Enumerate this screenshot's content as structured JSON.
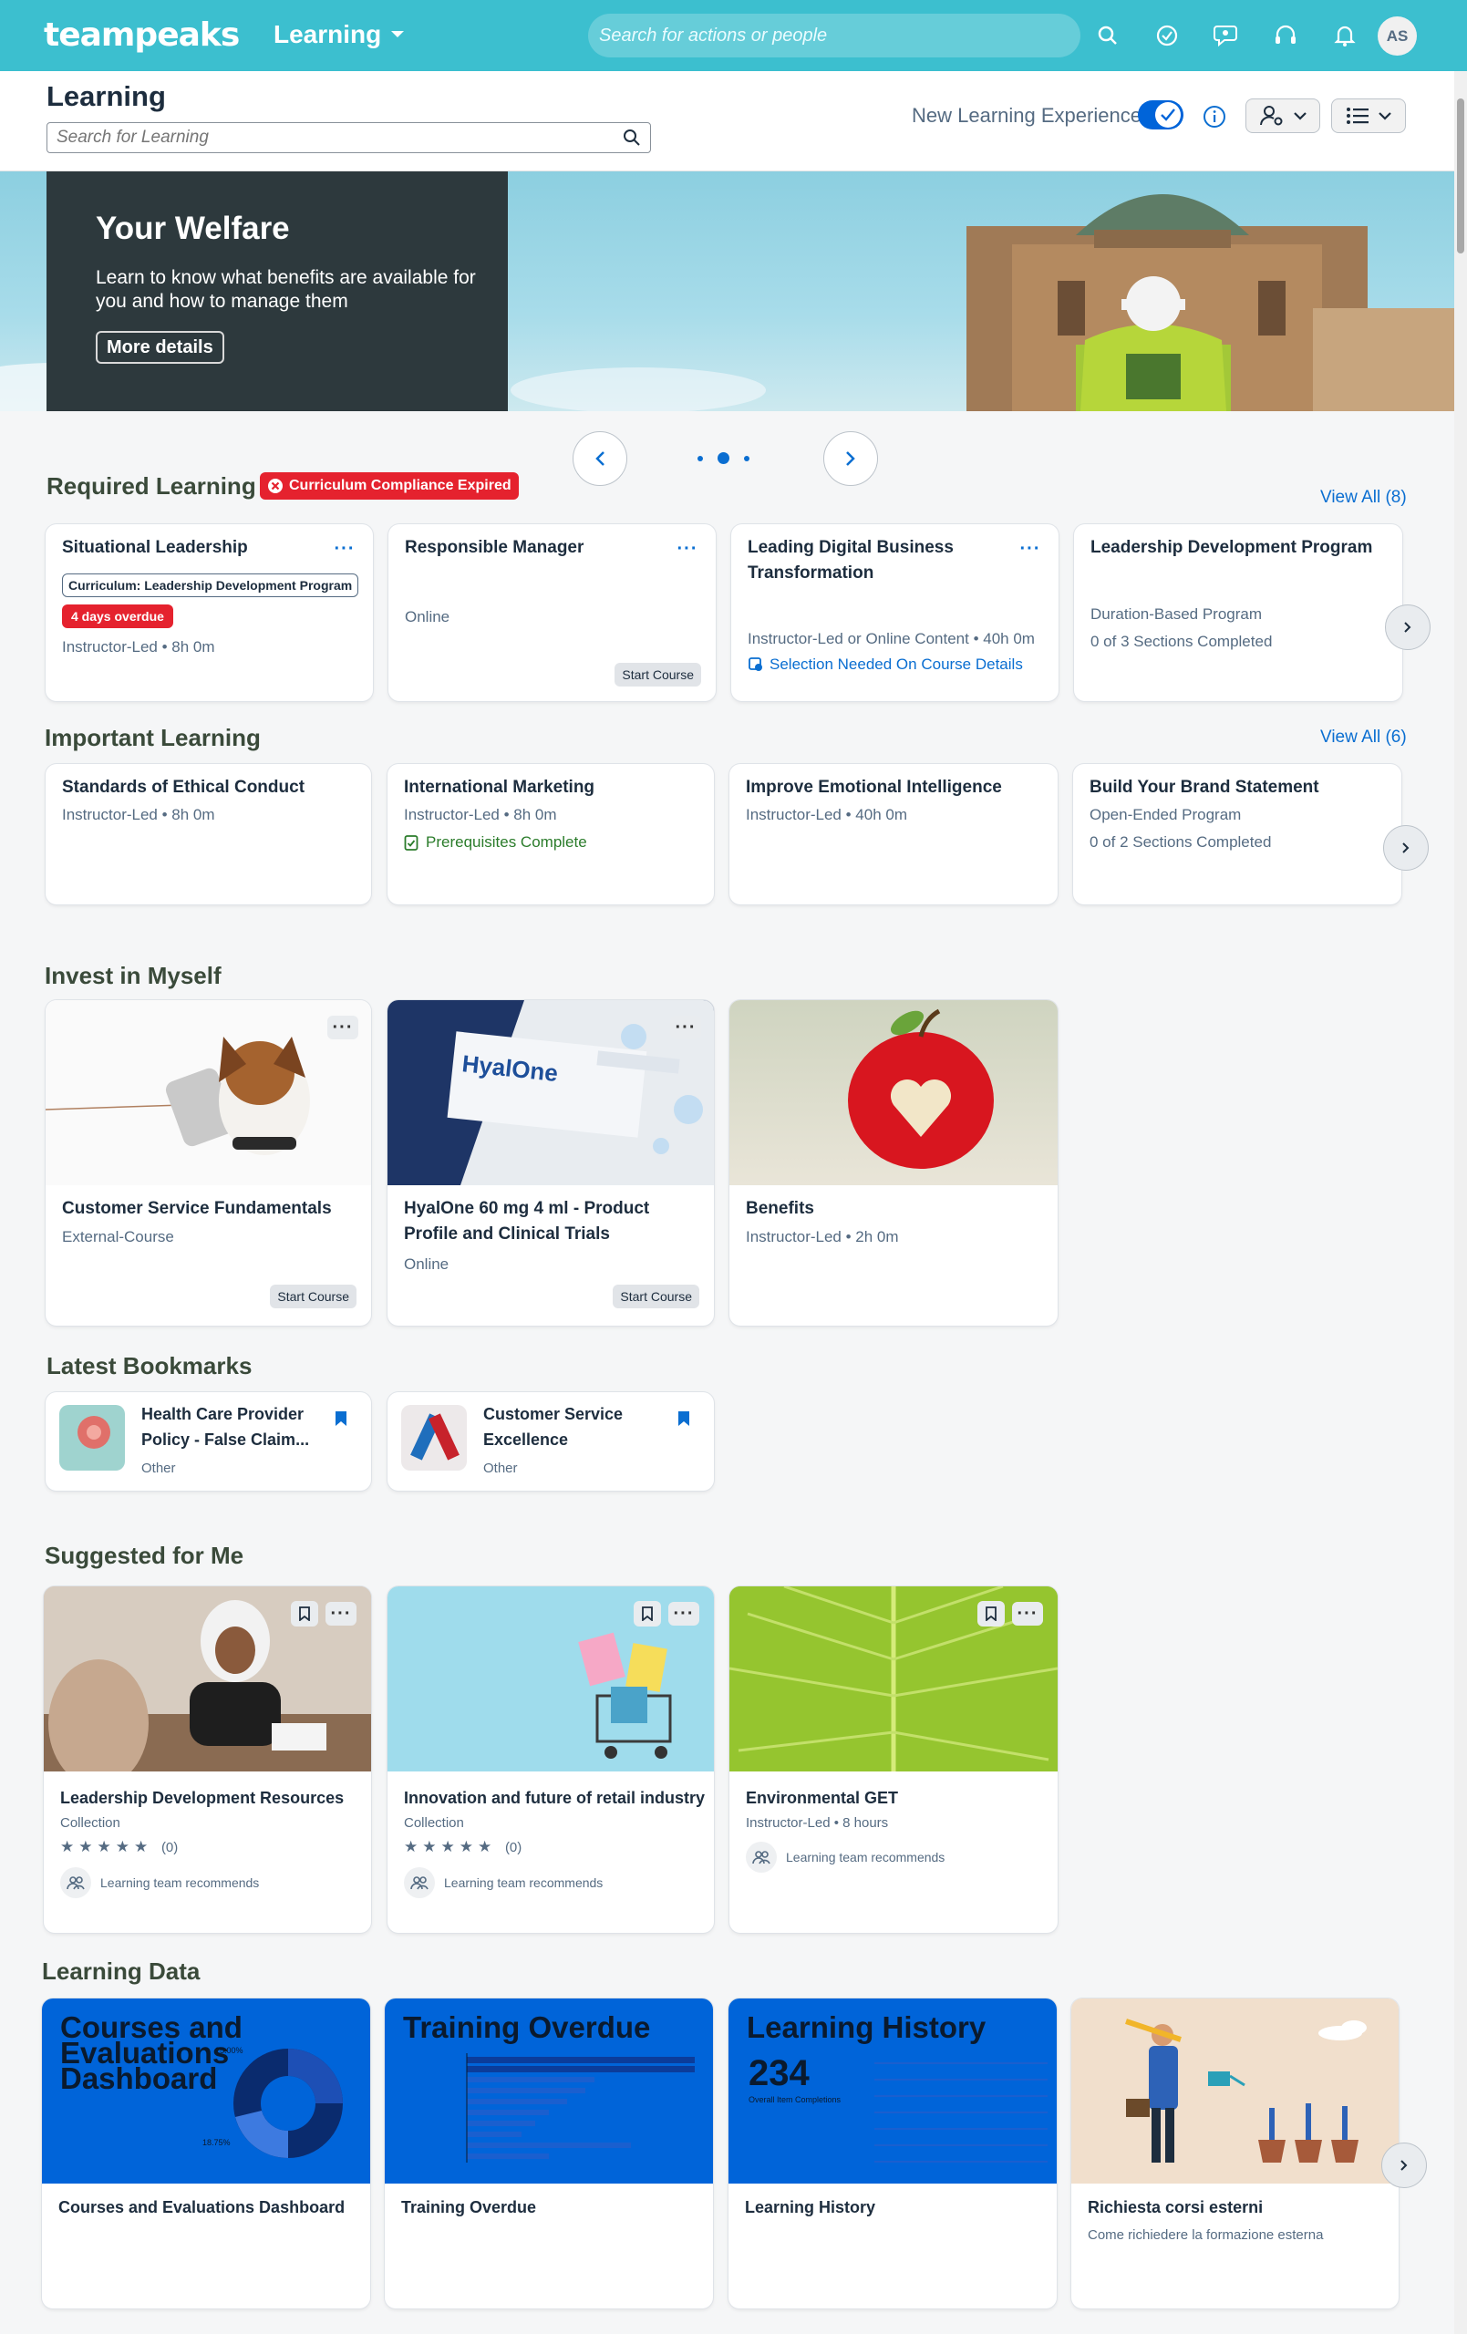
{
  "shell": {
    "logo": "teampeaks",
    "app_menu": "Learning",
    "search_placeholder": "Search for actions or people",
    "avatar_initials": "AS"
  },
  "header": {
    "title": "Learning",
    "search_placeholder": "Search for Learning",
    "new_experience_label": "New Learning Experience",
    "new_experience_on": true
  },
  "banner": {
    "title": "Your Welfare",
    "text": "Learn to know what benefits are available for you and how to manage them",
    "button": "More details",
    "slide_count": 3,
    "active_slide": 2
  },
  "required": {
    "title": "Required Learning",
    "badge": "Curriculum Compliance Expired",
    "view_all": "View All (8)",
    "cards": [
      {
        "title": "Situational Leadership",
        "tag": "Curriculum: Leadership Development Program",
        "overdue": "4 days overdue",
        "meta": "Instructor-Led • 8h 0m"
      },
      {
        "title": "Responsible Manager",
        "meta": "Online",
        "action": "Start Course"
      },
      {
        "title": "Leading Digital Business Transformation",
        "meta": "Instructor-Led or Online Content • 40h 0m",
        "link": "Selection Needed On Course Details"
      },
      {
        "title": "Leadership Development Program",
        "meta": "Duration-Based Program",
        "meta2": "0 of 3 Sections Completed"
      }
    ]
  },
  "important": {
    "title": "Important Learning",
    "view_all": "View All (6)",
    "cards": [
      {
        "title": "Standards of Ethical Conduct",
        "meta": "Instructor-Led • 8h 0m"
      },
      {
        "title": "International Marketing",
        "meta": "Instructor-Led • 8h 0m",
        "status": "Prerequisites Complete"
      },
      {
        "title": "Improve Emotional Intelligence",
        "meta": "Instructor-Led • 40h 0m"
      },
      {
        "title": "Build Your Brand Statement",
        "meta": "Open-Ended Program",
        "meta2": "0 of 2 Sections Completed"
      }
    ]
  },
  "invest": {
    "title": "Invest in Myself",
    "cards": [
      {
        "title": "Customer Service Fundamentals",
        "meta": "External-Course",
        "action": "Start Course"
      },
      {
        "title": "HyalOne 60 mg 4 ml - Product Profile and Clinical Trials",
        "meta": "Online",
        "action": "Start Course",
        "product_name": "HyalOne"
      },
      {
        "title": "Benefits",
        "meta": "Instructor-Led • 2h 0m"
      }
    ]
  },
  "bookmarks": {
    "title": "Latest Bookmarks",
    "cards": [
      {
        "title": "Health Care Provider Policy - False Claim...",
        "meta": "Other"
      },
      {
        "title": "Customer Service Excellence",
        "meta": "Other"
      }
    ]
  },
  "suggested": {
    "title": "Suggested for Me",
    "cards": [
      {
        "title": "Leadership Development Resources",
        "meta": "Collection",
        "rating": "★★★★★",
        "rating_count": "(0)",
        "rec": "Learning team recommends"
      },
      {
        "title": "Innovation and future of retail industry",
        "meta": "Collection",
        "rating": "★★★★★",
        "rating_count": "(0)",
        "rec": "Learning team recommends"
      },
      {
        "title": "Environmental GET",
        "meta": "Instructor-Led • 8 hours",
        "rec": "Learning team recommends"
      }
    ]
  },
  "learning_data": {
    "title": "Learning Data",
    "cards": [
      {
        "tile_title": "Courses and Evaluations Dashboard",
        "title": "Courses and Evaluations Dashboard",
        "pct_top": "25.00%",
        "pct_bottom": "18.75%"
      },
      {
        "tile_title": "Training Overdue",
        "title": "Training Overdue"
      },
      {
        "tile_title": "Learning History",
        "title": "Learning History",
        "big_number": "234",
        "big_caption": "Overall Item Completions"
      },
      {
        "title": "Richiesta corsi esterni",
        "meta": "Come richiedere la formazione esterna"
      }
    ]
  },
  "colors": {
    "shell": "#3cbfcf",
    "accent": "#0a6ed1",
    "danger": "#e5222e",
    "success": "#2b7c2b",
    "data_tile": "#0064d9"
  }
}
